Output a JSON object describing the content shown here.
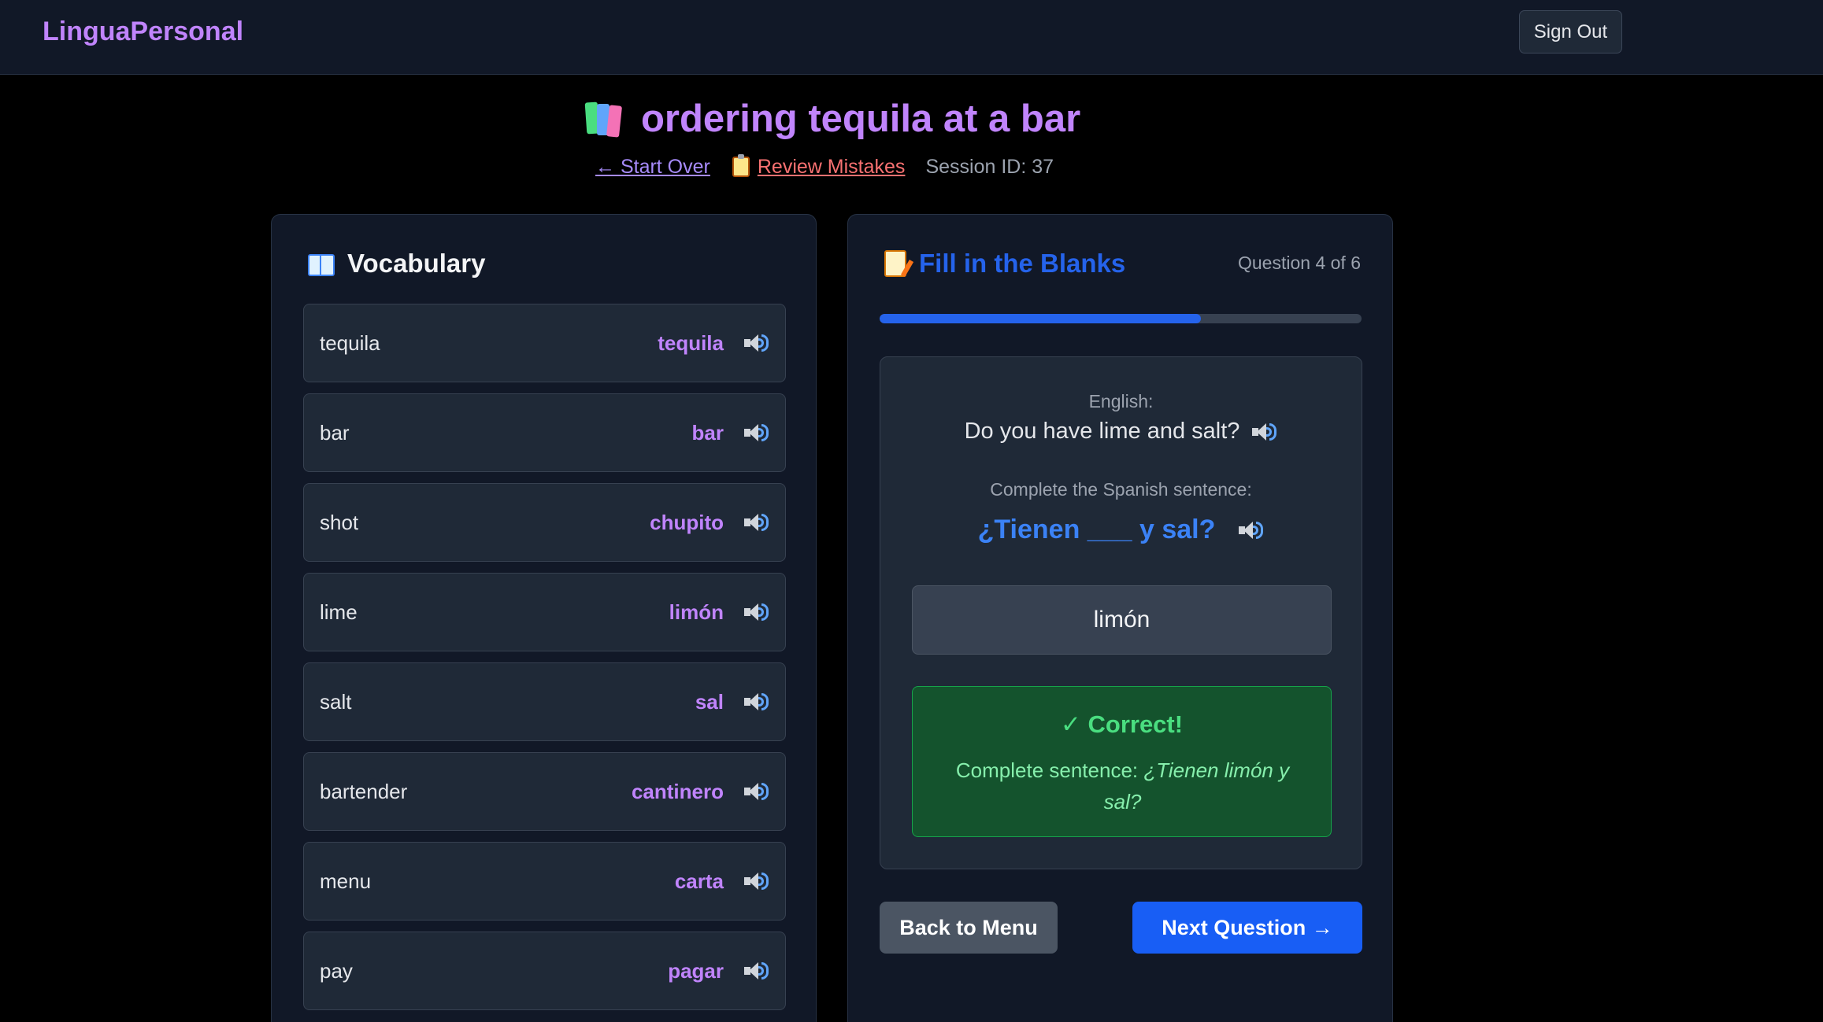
{
  "navbar": {
    "brand": "LinguaPersonal",
    "signout_label": "Sign Out"
  },
  "header": {
    "title": "ordering tequila at a bar",
    "title_icon": "books-icon",
    "start_over_label": "← Start Over",
    "review_label": "Review Mistakes",
    "review_icon": "clipboard-icon",
    "session_label": "Session ID: 37"
  },
  "vocabulary": {
    "heading": "Vocabulary",
    "heading_icon": "open-book-icon",
    "items": [
      {
        "english": "tequila",
        "spanish": "tequila"
      },
      {
        "english": "bar",
        "spanish": "bar"
      },
      {
        "english": "shot",
        "spanish": "chupito"
      },
      {
        "english": "lime",
        "spanish": "limón"
      },
      {
        "english": "salt",
        "spanish": "sal"
      },
      {
        "english": "bartender",
        "spanish": "cantinero"
      },
      {
        "english": "menu",
        "spanish": "carta"
      },
      {
        "english": "pay",
        "spanish": "pagar"
      }
    ]
  },
  "exercise": {
    "heading": "Fill in the Blanks",
    "heading_icon": "memo-icon",
    "question_counter": "Question 4 of 6",
    "progress_fraction": 0.667,
    "english_label": "English:",
    "english_sentence": "Do you have lime and salt?",
    "spanish_label": "Complete the Spanish sentence:",
    "spanish_sentence": "¿Tienen ___ y sal?",
    "answer_value": "limón",
    "feedback": {
      "title": "✓ Correct!",
      "prefix": "Complete sentence: ",
      "sentence": "¿Tienen limón y sal?"
    },
    "back_label": "Back to Menu",
    "next_label": "Next Question →"
  },
  "colors": {
    "accent_purple": "#c084fc",
    "accent_blue": "#2563eb",
    "success_green": "#4ade80",
    "error_red": "#f87171"
  }
}
